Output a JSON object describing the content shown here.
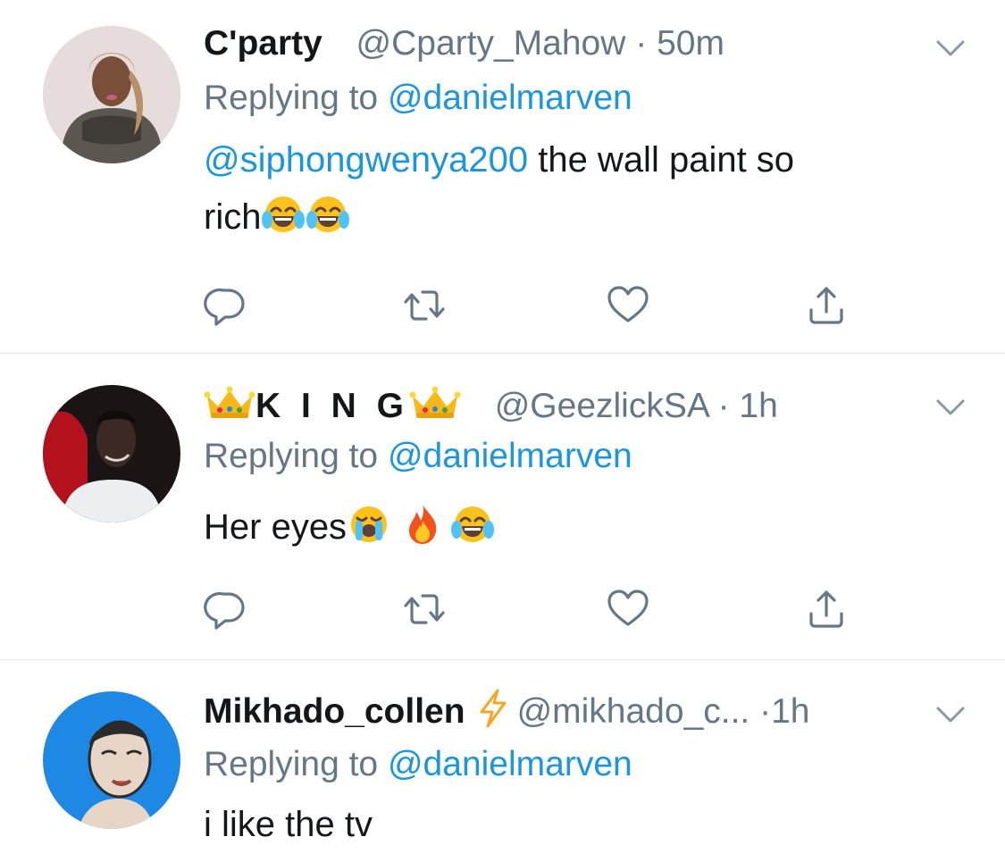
{
  "tweets": [
    {
      "display_name": "C'party",
      "handle": "@Cparty_Mahow",
      "separator": "·",
      "time": "50m",
      "replying_prefix": "Replying to",
      "replying_to": "@danielmarven",
      "mention": "@siphongwenya200",
      "text_line1": " the wall paint so",
      "text_line2": "rich",
      "emojis": [
        "face-with-tears-of-joy-emoji",
        "face-with-tears-of-joy-emoji"
      ]
    },
    {
      "display_name_prefix_icon": "crown-emoji",
      "display_name": "K I N G",
      "display_name_suffix_icon": "crown-emoji",
      "handle": "@GeezlickSA",
      "separator": "·",
      "time": "1h",
      "replying_prefix": "Replying to",
      "replying_to": "@danielmarven",
      "text_line1": "Her eyes",
      "emojis": [
        "loudly-crying-face-emoji",
        "fire-emoji",
        "face-with-tears-of-joy-emoji"
      ]
    },
    {
      "display_name": "Mikhado_collen",
      "display_name_suffix_icon": "lightning-emoji",
      "handle": "@mikhado_c...",
      "separator": "·",
      "time": "1h",
      "replying_prefix": "Replying to",
      "replying_to": "@danielmarven",
      "text_line1": "i like the tv"
    }
  ],
  "actions": [
    "reply-icon",
    "retweet-icon",
    "like-icon",
    "share-icon"
  ],
  "colors": {
    "link": "#1b95e0",
    "secondary_text": "#657786",
    "primary_text": "#14171a",
    "icon": "#657786",
    "divider": "#e1e8ed"
  }
}
